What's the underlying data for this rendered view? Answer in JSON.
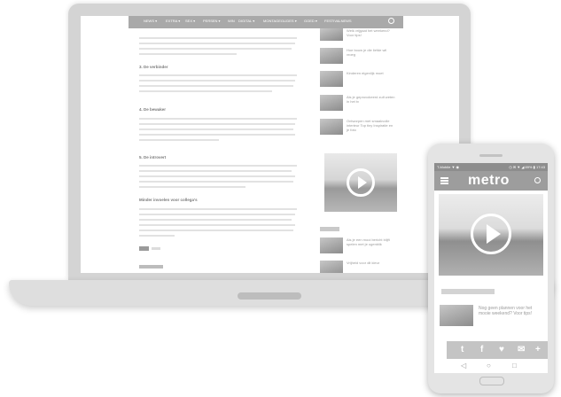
{
  "laptop": {
    "nav_items": [
      "NEWS ▾",
      "EXTRA ▾",
      "SEX ▾",
      "PERSEN ▾",
      "WIN",
      "DIGITAL ▾",
      "MONTAGEGLIDES ▾",
      "GOED ▾",
      "FESTIVALNEWS"
    ],
    "headings": [
      "3. De verbinder",
      "4. De bewaker",
      "5. De introvert",
      "Minder invoelen voor collega's"
    ],
    "sidebar_titles": [
      "Welk vrijgaat het weekend? Voor tips!",
      "Hoe bouw je die liefde wil vroeg",
      "Kinderen eigenlijk moet",
      "Als je een mooi bericht blijft spelen met je ogenblik",
      "Als je geprovokeerd zult weten in het tv",
      "Ontworpen met smaakvolle interieur Top tiny Inspiratie en je foto",
      "Vrijheid voor dit kleur"
    ],
    "phone_status_left": "T-Mobile ▼ ◉",
    "phone_status_right": "◷ ✉ ▼ ◢ 89% ▮ 17:43",
    "phone_logo": "metro",
    "phone_share_icons": [
      "f",
      "t",
      "f",
      "♥",
      "✉",
      "+"
    ],
    "phone_article_title": "Nog geen plannen voor het mooie weekend? Voor tips!",
    "phone_nav_icons": [
      "◁",
      "○",
      "□"
    ]
  },
  "colors": {
    "nav": "#a9a9a9",
    "phone_header": "#9d9d9d"
  }
}
